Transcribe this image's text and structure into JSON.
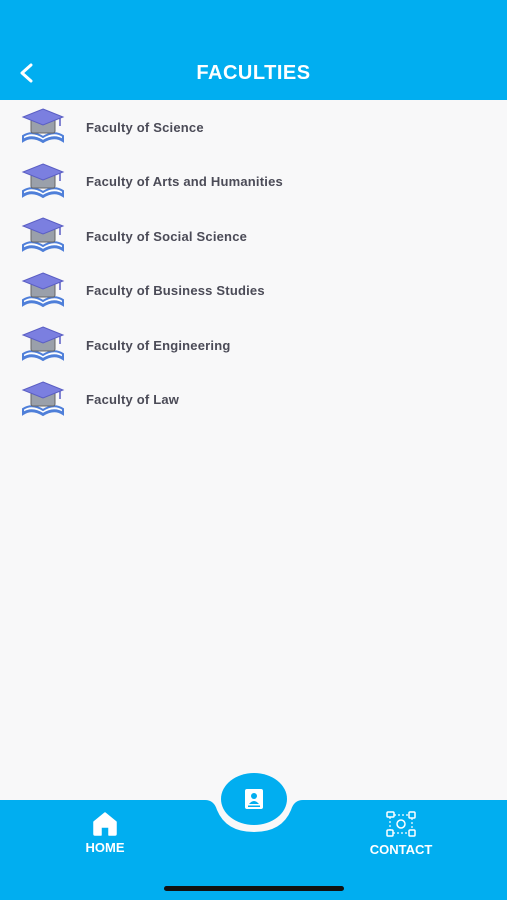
{
  "header": {
    "title": "FACULTIES",
    "back_icon": "chevron-left-icon"
  },
  "faculties": [
    {
      "label": "Faculty of Science",
      "icon": "graduation-book-icon"
    },
    {
      "label": "Faculty of Arts and Humanities",
      "icon": "graduation-book-icon"
    },
    {
      "label": "Faculty of Social Science",
      "icon": "graduation-book-icon"
    },
    {
      "label": "Faculty of Business Studies",
      "icon": "graduation-book-icon"
    },
    {
      "label": "Faculty of Engineering",
      "icon": "graduation-book-icon"
    },
    {
      "label": "Faculty of Law",
      "icon": "graduation-book-icon"
    }
  ],
  "bottom_nav": {
    "home_label": "HOME",
    "contact_label": "CONTACT",
    "center_icon": "contact-book-icon"
  },
  "colors": {
    "primary": "#01aef0",
    "background": "#f8f8f9",
    "text": "#4b4b57",
    "cap": "#7b7fe0"
  }
}
